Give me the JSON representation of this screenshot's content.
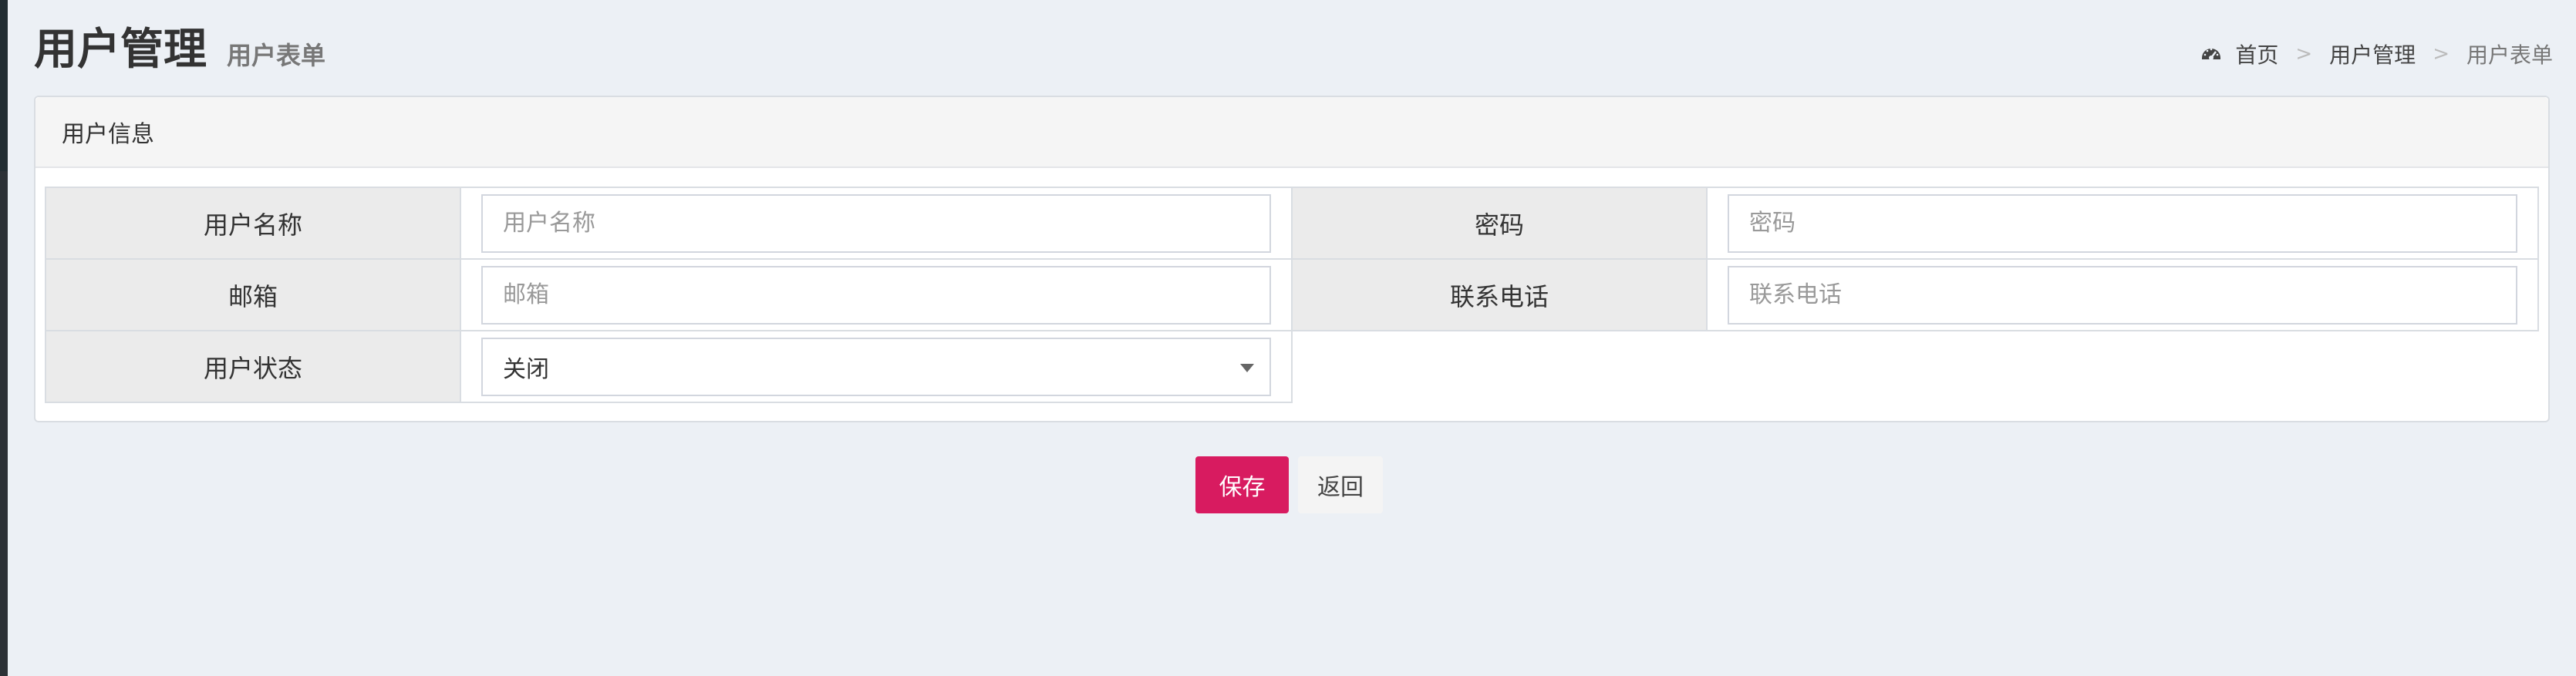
{
  "header": {
    "title": "用户管理",
    "subtitle": "用户表单"
  },
  "breadcrumb": {
    "icon": "dashboard-icon",
    "items": [
      "首页",
      "用户管理",
      "用户表单"
    ],
    "separator": ">"
  },
  "box": {
    "title": "用户信息"
  },
  "form": {
    "username": {
      "label": "用户名称",
      "placeholder": "用户名称",
      "value": ""
    },
    "password": {
      "label": "密码",
      "placeholder": "密码",
      "value": ""
    },
    "email": {
      "label": "邮箱",
      "placeholder": "邮箱",
      "value": ""
    },
    "phone": {
      "label": "联系电话",
      "placeholder": "联系电话",
      "value": ""
    },
    "status": {
      "label": "用户状态",
      "selected": "关闭"
    }
  },
  "actions": {
    "save_label": "保存",
    "back_label": "返回"
  },
  "colors": {
    "background": "#ecf0f5",
    "save_button": "#d81b60",
    "label_cell": "#ebebeb"
  }
}
